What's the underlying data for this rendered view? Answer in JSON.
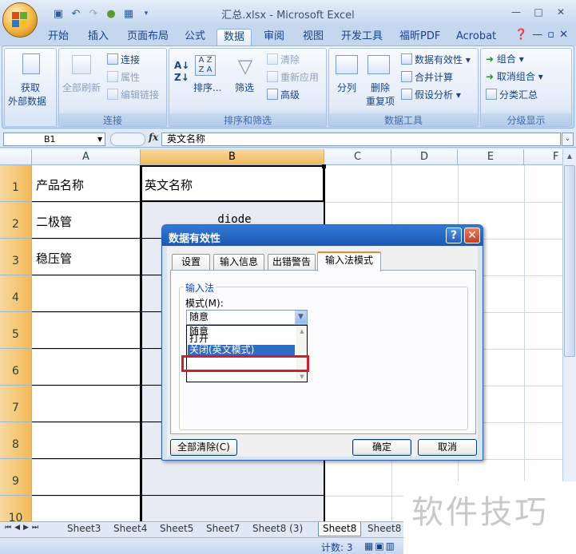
{
  "window": {
    "title": "汇总.xlsx - Microsoft Excel",
    "controls": [
      "—",
      "□",
      "✕"
    ]
  },
  "qat": {
    "icons": [
      "save-icon",
      "undo-icon",
      "redo-icon",
      "circle-icon",
      "form-icon"
    ]
  },
  "ribbon_tabs": [
    "开始",
    "插入",
    "页面布局",
    "公式",
    "数据",
    "审阅",
    "视图",
    "开发工具",
    "福昕PDF",
    "Acrobat"
  ],
  "active_tab": "数据",
  "ribbon": {
    "get_external": "获取\n外部数据",
    "get_external_l1": "获取",
    "get_external_l2": "外部数据",
    "refresh_all": "全部刷新",
    "connections": "连接",
    "properties": "属性",
    "edit_links": "编辑链接",
    "group_connections": "连接",
    "sort_az": "A↓Z",
    "sort": "排序...",
    "filter": "筛选",
    "clear": "清除",
    "reapply": "重新应用",
    "advanced": "高级",
    "group_sort_filter": "排序和筛选",
    "text_to_columns": "分列",
    "remove_dup_l1": "删除",
    "remove_dup_l2": "重复项",
    "data_validation": "数据有效性",
    "consolidate": "合并计算",
    "what_if": "假设分析",
    "group_data_tools": "数据工具",
    "group": "组合",
    "ungroup": "取消组合",
    "subtotal": "分类汇总",
    "group_outline": "分级显示"
  },
  "formula_bar": {
    "name_box": "B1",
    "fx": "fx",
    "value": "英文名称"
  },
  "grid": {
    "columns": [
      "A",
      "B",
      "C",
      "D",
      "E",
      "F"
    ],
    "rows": [
      "1",
      "2",
      "3",
      "4",
      "5",
      "6",
      "7",
      "8",
      "9",
      "10"
    ],
    "cells": {
      "A1": "产品名称",
      "B1": "英文名称",
      "A2": "二极管",
      "B2": "diode",
      "A3": "稳压管"
    }
  },
  "sheets": [
    "Sheet3",
    "Sheet4",
    "Sheet5",
    "Sheet7",
    "Sheet8 (3)",
    "Sheet8",
    "Sheet8"
  ],
  "active_sheet_index": 5,
  "status": {
    "count": "计数: 3"
  },
  "watermark": "软件技巧",
  "dialog": {
    "title": "数据有效性",
    "help": "?",
    "close": "✕",
    "tabs": [
      "设置",
      "输入信息",
      "出错警告",
      "输入法模式"
    ],
    "active_tab": "输入法模式",
    "section": "输入法",
    "mode_label": "模式(M):",
    "combo_value": "随意",
    "options": [
      "随意",
      "打开",
      "关闭(英文模式)"
    ],
    "highlighted_option": "关闭(英文模式)",
    "clear_all": "全部清除(C)",
    "ok": "确定",
    "cancel": "取消"
  }
}
